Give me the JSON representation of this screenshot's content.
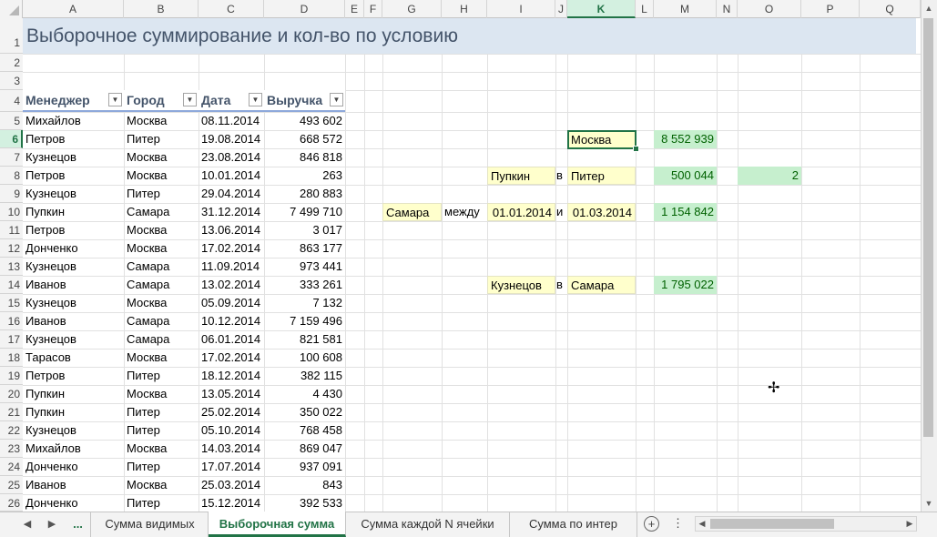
{
  "columns": [
    "A",
    "B",
    "C",
    "D",
    "E",
    "F",
    "G",
    "H",
    "I",
    "J",
    "K",
    "L",
    "M",
    "N",
    "O",
    "P",
    "Q"
  ],
  "selected_column": "K",
  "rows": [
    "1",
    "2",
    "3",
    "4",
    "5",
    "6",
    "7",
    "8",
    "9",
    "10",
    "11",
    "12",
    "13",
    "14",
    "15",
    "16",
    "17",
    "18",
    "19",
    "20",
    "21",
    "22",
    "23",
    "24",
    "25",
    "26"
  ],
  "selected_row": "6",
  "title": "Выборочное суммирование и кол-во по условию",
  "table_headers": [
    "Менеджер",
    "Город",
    "Дата",
    "Выручка"
  ],
  "filter_icon": "▼",
  "table_rows": [
    [
      "Михайлов",
      "Москва",
      "08.11.2014",
      "493 602"
    ],
    [
      "Петров",
      "Питер",
      "19.08.2014",
      "668 572"
    ],
    [
      "Кузнецов",
      "Москва",
      "23.08.2014",
      "846 818"
    ],
    [
      "Петров",
      "Москва",
      "10.01.2014",
      "263"
    ],
    [
      "Кузнецов",
      "Питер",
      "29.04.2014",
      "280 883"
    ],
    [
      "Пупкин",
      "Самара",
      "31.12.2014",
      "7 499 710"
    ],
    [
      "Петров",
      "Москва",
      "13.06.2014",
      "3 017"
    ],
    [
      "Донченко",
      "Москва",
      "17.02.2014",
      "863 177"
    ],
    [
      "Кузнецов",
      "Самара",
      "11.09.2014",
      "973 441"
    ],
    [
      "Иванов",
      "Самара",
      "13.02.2014",
      "333 261"
    ],
    [
      "Кузнецов",
      "Москва",
      "05.09.2014",
      "7 132"
    ],
    [
      "Иванов",
      "Самара",
      "10.12.2014",
      "7 159 496"
    ],
    [
      "Кузнецов",
      "Самара",
      "06.01.2014",
      "821 581"
    ],
    [
      "Тарасов",
      "Москва",
      "17.02.2014",
      "100 608"
    ],
    [
      "Петров",
      "Питер",
      "18.12.2014",
      "382 115"
    ],
    [
      "Пупкин",
      "Москва",
      "13.05.2014",
      "4 430"
    ],
    [
      "Пупкин",
      "Питер",
      "25.02.2014",
      "350 022"
    ],
    [
      "Кузнецов",
      "Питер",
      "05.10.2014",
      "768 458"
    ],
    [
      "Михайлов",
      "Москва",
      "14.03.2014",
      "869 047"
    ],
    [
      "Донченко",
      "Питер",
      "17.07.2014",
      "937 091"
    ],
    [
      "Иванов",
      "Москва",
      "25.03.2014",
      "843"
    ],
    [
      "Донченко",
      "Питер",
      "15.12.2014",
      "392 533"
    ]
  ],
  "criteria": {
    "k6": "Москва",
    "m6": "8 552 939",
    "i8": "Пупкин",
    "j8": "в",
    "k8": "Питер",
    "m8": "500 044",
    "o8": "2",
    "g10": "Самара",
    "h10": "между",
    "i10": "01.01.2014",
    "j10": "и",
    "k10": "01.03.2014",
    "m10": "1 154 842",
    "i14": "Кузнецов",
    "j14": "в",
    "k14": "Самара",
    "m14": "1 795 022"
  },
  "sheet_tabs": {
    "more": "...",
    "items": [
      "Сумма видимых",
      "Выборочная сумма",
      "Сумма каждой N ячейки",
      "Сумма по интер"
    ],
    "active": "Выборочная сумма"
  },
  "nav": {
    "prev": "◀",
    "next": "▶"
  },
  "add_sheet": "+",
  "more_menu": "⋮",
  "cursor_icon": "✢",
  "colors": {
    "accent": "#217346",
    "title_fill": "#dce6f1",
    "title_text": "#44546a",
    "input_fill": "#ffffcc",
    "result_fill": "#c6efce",
    "result_text": "#006100"
  }
}
